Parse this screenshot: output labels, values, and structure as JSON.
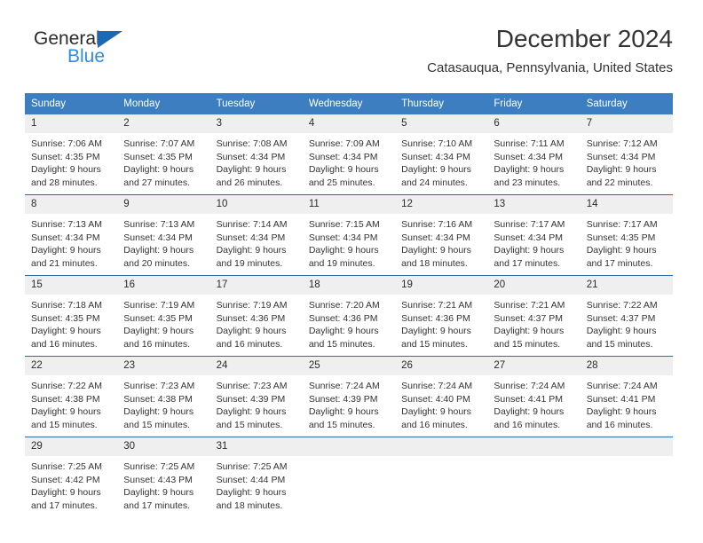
{
  "brand": {
    "name_top": "General",
    "name_bottom": "Blue",
    "triangle_color": "#1a69b5",
    "blue_text_color": "#2e8ddd"
  },
  "header": {
    "title": "December 2024",
    "subtitle": "Catasauqua, Pennsylvania, United States"
  },
  "theme": {
    "header_bar": "#3c7ebf",
    "row_divider": "#2c6ca8",
    "daynum_band": "#efefef",
    "text": "#333333"
  },
  "weekday_headers": [
    "Sunday",
    "Monday",
    "Tuesday",
    "Wednesday",
    "Thursday",
    "Friday",
    "Saturday"
  ],
  "weeks": [
    {
      "days": [
        {
          "num": "1",
          "sunrise": "Sunrise: 7:06 AM",
          "sunset": "Sunset: 4:35 PM",
          "daylight1": "Daylight: 9 hours",
          "daylight2": "and 28 minutes."
        },
        {
          "num": "2",
          "sunrise": "Sunrise: 7:07 AM",
          "sunset": "Sunset: 4:35 PM",
          "daylight1": "Daylight: 9 hours",
          "daylight2": "and 27 minutes."
        },
        {
          "num": "3",
          "sunrise": "Sunrise: 7:08 AM",
          "sunset": "Sunset: 4:34 PM",
          "daylight1": "Daylight: 9 hours",
          "daylight2": "and 26 minutes."
        },
        {
          "num": "4",
          "sunrise": "Sunrise: 7:09 AM",
          "sunset": "Sunset: 4:34 PM",
          "daylight1": "Daylight: 9 hours",
          "daylight2": "and 25 minutes."
        },
        {
          "num": "5",
          "sunrise": "Sunrise: 7:10 AM",
          "sunset": "Sunset: 4:34 PM",
          "daylight1": "Daylight: 9 hours",
          "daylight2": "and 24 minutes."
        },
        {
          "num": "6",
          "sunrise": "Sunrise: 7:11 AM",
          "sunset": "Sunset: 4:34 PM",
          "daylight1": "Daylight: 9 hours",
          "daylight2": "and 23 minutes."
        },
        {
          "num": "7",
          "sunrise": "Sunrise: 7:12 AM",
          "sunset": "Sunset: 4:34 PM",
          "daylight1": "Daylight: 9 hours",
          "daylight2": "and 22 minutes."
        }
      ]
    },
    {
      "days": [
        {
          "num": "8",
          "sunrise": "Sunrise: 7:13 AM",
          "sunset": "Sunset: 4:34 PM",
          "daylight1": "Daylight: 9 hours",
          "daylight2": "and 21 minutes."
        },
        {
          "num": "9",
          "sunrise": "Sunrise: 7:13 AM",
          "sunset": "Sunset: 4:34 PM",
          "daylight1": "Daylight: 9 hours",
          "daylight2": "and 20 minutes."
        },
        {
          "num": "10",
          "sunrise": "Sunrise: 7:14 AM",
          "sunset": "Sunset: 4:34 PM",
          "daylight1": "Daylight: 9 hours",
          "daylight2": "and 19 minutes."
        },
        {
          "num": "11",
          "sunrise": "Sunrise: 7:15 AM",
          "sunset": "Sunset: 4:34 PM",
          "daylight1": "Daylight: 9 hours",
          "daylight2": "and 19 minutes."
        },
        {
          "num": "12",
          "sunrise": "Sunrise: 7:16 AM",
          "sunset": "Sunset: 4:34 PM",
          "daylight1": "Daylight: 9 hours",
          "daylight2": "and 18 minutes."
        },
        {
          "num": "13",
          "sunrise": "Sunrise: 7:17 AM",
          "sunset": "Sunset: 4:34 PM",
          "daylight1": "Daylight: 9 hours",
          "daylight2": "and 17 minutes."
        },
        {
          "num": "14",
          "sunrise": "Sunrise: 7:17 AM",
          "sunset": "Sunset: 4:35 PM",
          "daylight1": "Daylight: 9 hours",
          "daylight2": "and 17 minutes."
        }
      ]
    },
    {
      "days": [
        {
          "num": "15",
          "sunrise": "Sunrise: 7:18 AM",
          "sunset": "Sunset: 4:35 PM",
          "daylight1": "Daylight: 9 hours",
          "daylight2": "and 16 minutes."
        },
        {
          "num": "16",
          "sunrise": "Sunrise: 7:19 AM",
          "sunset": "Sunset: 4:35 PM",
          "daylight1": "Daylight: 9 hours",
          "daylight2": "and 16 minutes."
        },
        {
          "num": "17",
          "sunrise": "Sunrise: 7:19 AM",
          "sunset": "Sunset: 4:36 PM",
          "daylight1": "Daylight: 9 hours",
          "daylight2": "and 16 minutes."
        },
        {
          "num": "18",
          "sunrise": "Sunrise: 7:20 AM",
          "sunset": "Sunset: 4:36 PM",
          "daylight1": "Daylight: 9 hours",
          "daylight2": "and 15 minutes."
        },
        {
          "num": "19",
          "sunrise": "Sunrise: 7:21 AM",
          "sunset": "Sunset: 4:36 PM",
          "daylight1": "Daylight: 9 hours",
          "daylight2": "and 15 minutes."
        },
        {
          "num": "20",
          "sunrise": "Sunrise: 7:21 AM",
          "sunset": "Sunset: 4:37 PM",
          "daylight1": "Daylight: 9 hours",
          "daylight2": "and 15 minutes."
        },
        {
          "num": "21",
          "sunrise": "Sunrise: 7:22 AM",
          "sunset": "Sunset: 4:37 PM",
          "daylight1": "Daylight: 9 hours",
          "daylight2": "and 15 minutes."
        }
      ]
    },
    {
      "days": [
        {
          "num": "22",
          "sunrise": "Sunrise: 7:22 AM",
          "sunset": "Sunset: 4:38 PM",
          "daylight1": "Daylight: 9 hours",
          "daylight2": "and 15 minutes."
        },
        {
          "num": "23",
          "sunrise": "Sunrise: 7:23 AM",
          "sunset": "Sunset: 4:38 PM",
          "daylight1": "Daylight: 9 hours",
          "daylight2": "and 15 minutes."
        },
        {
          "num": "24",
          "sunrise": "Sunrise: 7:23 AM",
          "sunset": "Sunset: 4:39 PM",
          "daylight1": "Daylight: 9 hours",
          "daylight2": "and 15 minutes."
        },
        {
          "num": "25",
          "sunrise": "Sunrise: 7:24 AM",
          "sunset": "Sunset: 4:39 PM",
          "daylight1": "Daylight: 9 hours",
          "daylight2": "and 15 minutes."
        },
        {
          "num": "26",
          "sunrise": "Sunrise: 7:24 AM",
          "sunset": "Sunset: 4:40 PM",
          "daylight1": "Daylight: 9 hours",
          "daylight2": "and 16 minutes."
        },
        {
          "num": "27",
          "sunrise": "Sunrise: 7:24 AM",
          "sunset": "Sunset: 4:41 PM",
          "daylight1": "Daylight: 9 hours",
          "daylight2": "and 16 minutes."
        },
        {
          "num": "28",
          "sunrise": "Sunrise: 7:24 AM",
          "sunset": "Sunset: 4:41 PM",
          "daylight1": "Daylight: 9 hours",
          "daylight2": "and 16 minutes."
        }
      ]
    },
    {
      "days": [
        {
          "num": "29",
          "sunrise": "Sunrise: 7:25 AM",
          "sunset": "Sunset: 4:42 PM",
          "daylight1": "Daylight: 9 hours",
          "daylight2": "and 17 minutes."
        },
        {
          "num": "30",
          "sunrise": "Sunrise: 7:25 AM",
          "sunset": "Sunset: 4:43 PM",
          "daylight1": "Daylight: 9 hours",
          "daylight2": "and 17 minutes."
        },
        {
          "num": "31",
          "sunrise": "Sunrise: 7:25 AM",
          "sunset": "Sunset: 4:44 PM",
          "daylight1": "Daylight: 9 hours",
          "daylight2": "and 18 minutes."
        },
        {
          "num": "",
          "sunrise": "",
          "sunset": "",
          "daylight1": "",
          "daylight2": ""
        },
        {
          "num": "",
          "sunrise": "",
          "sunset": "",
          "daylight1": "",
          "daylight2": ""
        },
        {
          "num": "",
          "sunrise": "",
          "sunset": "",
          "daylight1": "",
          "daylight2": ""
        },
        {
          "num": "",
          "sunrise": "",
          "sunset": "",
          "daylight1": "",
          "daylight2": ""
        }
      ]
    }
  ]
}
